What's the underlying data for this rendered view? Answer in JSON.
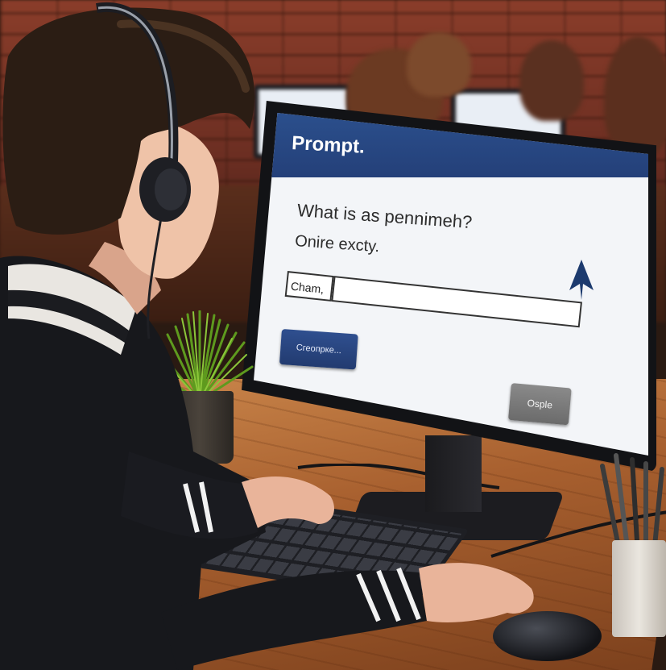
{
  "dialog": {
    "title": "Prompt.",
    "question": "What is as pennimeh?",
    "subtext": "Onire excty.",
    "input_label": "Cham,",
    "input_value": "",
    "primary_button": "Сгеопрке...",
    "secondary_button": "Osple"
  },
  "colors": {
    "titlebar": "#2b4f8c",
    "primary_button": "#2f4f8f",
    "secondary_button": "#7a7a7a",
    "screen_bg": "#f3f5f8"
  },
  "icons": {
    "cursor": "arrow-cursor-icon"
  }
}
